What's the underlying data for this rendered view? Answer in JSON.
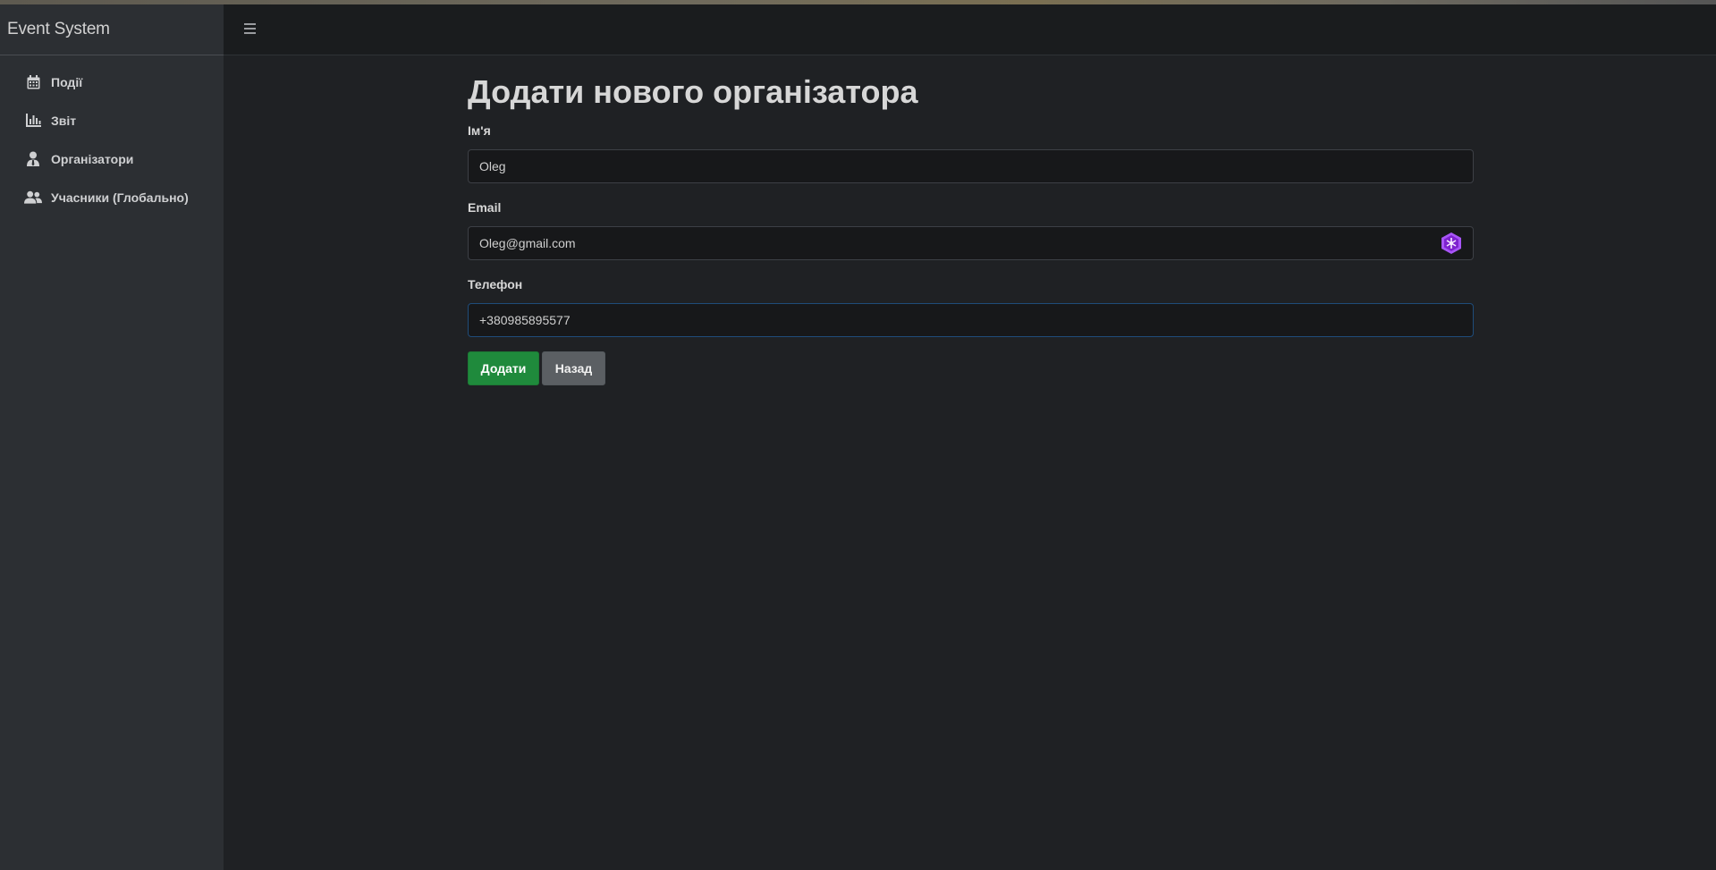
{
  "app": {
    "brand": "Event System",
    "top_strip_color": "#6f6a5c"
  },
  "sidebar": {
    "items": [
      {
        "label": "Події",
        "icon": "calendar-icon"
      },
      {
        "label": "Звіт",
        "icon": "bar-chart-icon"
      },
      {
        "label": "Організатори",
        "icon": "user-tie-icon"
      },
      {
        "label": "Учасники (Глобально)",
        "icon": "users-icon"
      }
    ]
  },
  "topbar": {
    "menu_icon": "hamburger-menu-icon"
  },
  "form": {
    "title": "Додати нового організатора",
    "name": {
      "label": "Ім'я",
      "value": "Oleg"
    },
    "email": {
      "label": "Email",
      "value": "Oleg@gmail.com",
      "ext_icon": "password-manager-icon",
      "ext_icon_color": "#a855f7"
    },
    "phone": {
      "label": "Телефон",
      "value": "+380985895577"
    },
    "submit_label": "Додати",
    "back_label": "Назад"
  },
  "colors": {
    "success": "#1f8a3c",
    "secondary": "#5b5f63",
    "background": "#1f2124",
    "sidebar": "#2c2f33"
  }
}
